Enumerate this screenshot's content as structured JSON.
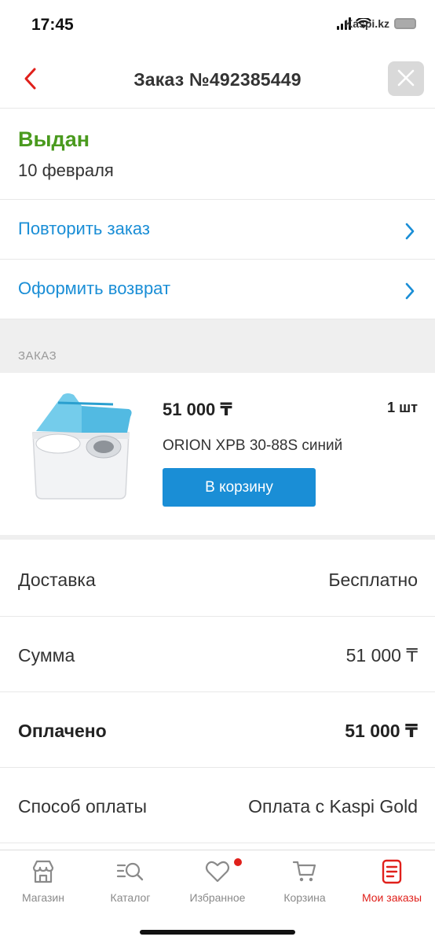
{
  "status_bar": {
    "time": "17:45",
    "watermark": "Kaspi.kz"
  },
  "header": {
    "title": "Заказ №492385449",
    "back_icon": "chevron-left-icon",
    "close_icon": "close-icon"
  },
  "order_status": {
    "text": "Выдан",
    "date": "10 февраля",
    "color": "#4a9a1e"
  },
  "actions": [
    {
      "label": "Повторить заказ"
    },
    {
      "label": "Оформить возврат"
    }
  ],
  "section": {
    "title": "ЗАКАЗ"
  },
  "product": {
    "price": "51 000 ₸",
    "quantity": "1 шт",
    "name": "ORION XPB 30-88S синий",
    "cart_button": "В корзину"
  },
  "summary": [
    {
      "label": "Доставка",
      "value": "Бесплатно"
    },
    {
      "label": "Сумма",
      "value": "51 000 ₸"
    },
    {
      "label": "Оплачено",
      "value": "51 000 ₸"
    },
    {
      "label": "Способ оплаты",
      "value": "Оплата с Kaspi Gold"
    }
  ],
  "tabs": [
    {
      "label": "Магазин",
      "icon": "store-icon"
    },
    {
      "label": "Каталог",
      "icon": "catalog-search-icon"
    },
    {
      "label": "Избранное",
      "icon": "heart-icon"
    },
    {
      "label": "Корзина",
      "icon": "cart-icon"
    },
    {
      "label": "Мои заказы",
      "icon": "orders-icon"
    }
  ],
  "colors": {
    "accent_blue": "#1a8ed6",
    "active_red": "#e0201b",
    "status_green": "#4a9a1e"
  }
}
